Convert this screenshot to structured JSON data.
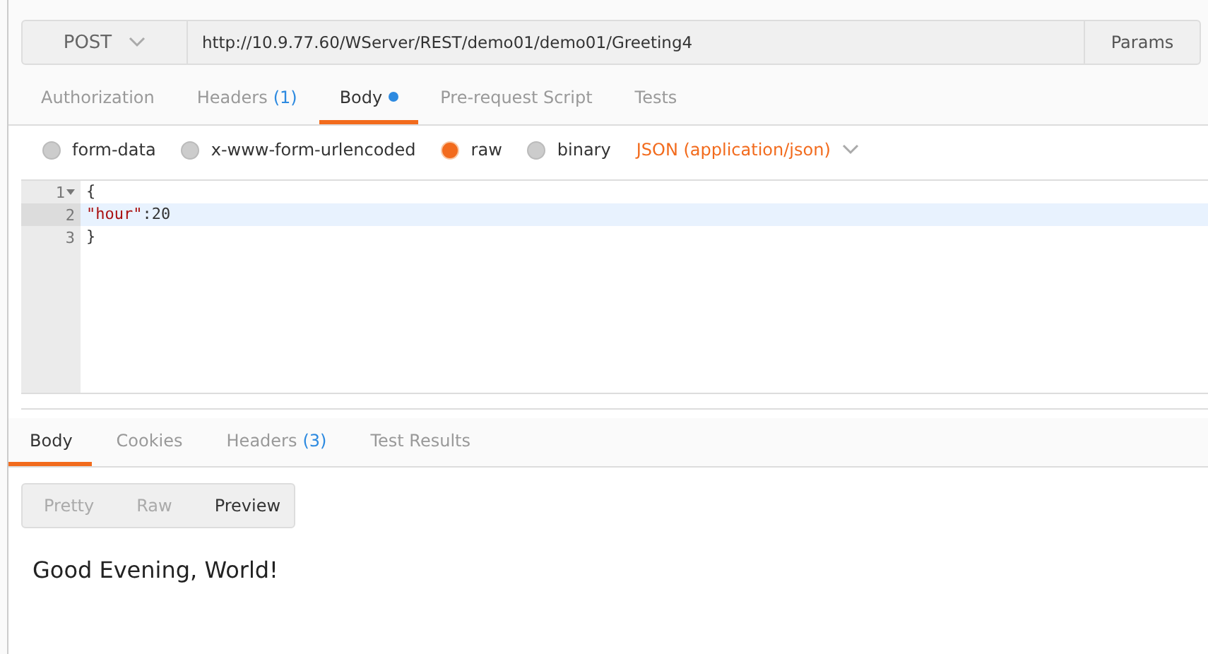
{
  "request": {
    "method": "POST",
    "url": "http://10.9.77.60/WServer/REST/demo01/demo01/Greeting4",
    "params_button": "Params"
  },
  "request_tabs": [
    {
      "label": "Authorization",
      "selected": false
    },
    {
      "label": "Headers",
      "count": "(1)",
      "selected": false
    },
    {
      "label": "Body",
      "selected": true,
      "modified": true
    },
    {
      "label": "Pre-request Script",
      "selected": false
    },
    {
      "label": "Tests",
      "selected": false
    }
  ],
  "body_types": [
    {
      "label": "form-data",
      "selected": false
    },
    {
      "label": "x-www-form-urlencoded",
      "selected": false
    },
    {
      "label": "raw",
      "selected": true
    },
    {
      "label": "binary",
      "selected": false
    }
  ],
  "content_type": "JSON (application/json)",
  "editor": {
    "lines": [
      {
        "number": "1",
        "foldable": true,
        "active": false,
        "text": "{"
      },
      {
        "number": "2",
        "foldable": false,
        "active": true,
        "key": "\"hour\"",
        "text": ":20"
      },
      {
        "number": "3",
        "foldable": false,
        "active": false,
        "text": "}"
      }
    ]
  },
  "response_tabs": [
    {
      "label": "Body",
      "selected": true
    },
    {
      "label": "Cookies",
      "selected": false
    },
    {
      "label": "Headers",
      "count": "(3)",
      "selected": false
    },
    {
      "label": "Test Results",
      "selected": false
    }
  ],
  "view_modes": [
    {
      "label": "Pretty",
      "selected": false
    },
    {
      "label": "Raw",
      "selected": false
    },
    {
      "label": "Preview",
      "selected": true
    }
  ],
  "preview_text": "Good Evening, World!"
}
